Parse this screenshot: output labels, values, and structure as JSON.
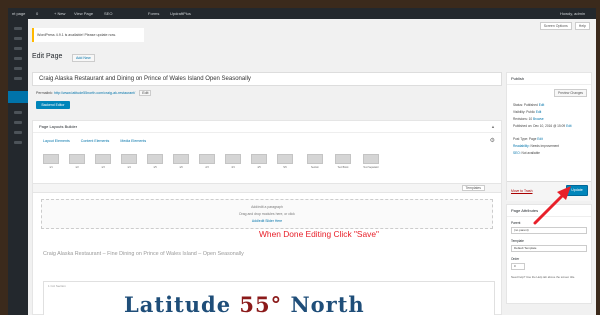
{
  "adminbar": {
    "site": "nt page",
    "comments": "0",
    "new": "+ New",
    "view": "View Page",
    "seo": "SEO",
    "forms": "Forms",
    "updraft": "UpdraftPlus",
    "howdy": "Howdy, admin"
  },
  "top_tabs": [
    "Screen Options",
    "Help"
  ],
  "notice": "WordPress 4.9.1 is available! Please update now.",
  "heading": {
    "title": "Edit Page",
    "add_new": "Add New"
  },
  "post_title": "Craig Alaska Restaurant and Dining on Prince of Wales Island Open Seasonally",
  "permalink": {
    "label": "Permalink:",
    "url": "http://www.latitude55north.com/craig-ak-restaurant/",
    "edit": "Edit"
  },
  "backend_button": "Backend Editor",
  "builder": {
    "title": "Page Layouts Builder",
    "tabs": [
      "Layout Elements",
      "Content Elements",
      "Media Elements"
    ],
    "layouts": [
      "1/1",
      "1/2",
      "1/3",
      "1/4",
      "1/5",
      "1/6",
      "2/3",
      "3/4",
      "4/5",
      "5/6",
      "Section",
      "Text Block",
      "Text Separator"
    ],
    "templates_button": "Templates",
    "drop_lines": [
      "Add/edit a paragraph",
      "Drag and drop modules here, or click",
      "Add/edit Slider Here"
    ],
    "callout": "When Done Editing Click \"Save\"",
    "page_heading": "Craig Alaska Restaurant – Fine Dining on Prince of Wales Island – Open Seasonally",
    "row_label": "1 Col Section",
    "logo": {
      "word1": "Latitude",
      "num": "55°",
      "word2": "North"
    }
  },
  "publish": {
    "title": "Publish",
    "preview": "Preview Changes",
    "rows": [
      {
        "label": "Status:",
        "value": "Published",
        "link": "Edit"
      },
      {
        "label": "Visibility:",
        "value": "Public",
        "link": "Edit"
      },
      {
        "label": "Revisions:",
        "value": "10",
        "link": "Browse"
      },
      {
        "label": "Published on:",
        "value": "Dec 10, 2016 @ 15:09",
        "link": "Edit"
      },
      {
        "label": "Post Type:",
        "value": "Page",
        "link": "Edit"
      },
      {
        "label": "Readability:",
        "value": "Needs improvement",
        "link": ""
      },
      {
        "label": "SEO:",
        "value": "Not available",
        "link": ""
      }
    ],
    "trash": "Move to Trash",
    "update": "Update"
  },
  "attributes": {
    "title": "Page Attributes",
    "parent_label": "Parent",
    "parent_value": "(no parent)",
    "template_label": "Template",
    "template_value": "Default Template",
    "order_label": "Order",
    "order_value": "0",
    "help": "Need help? Use the Help tab above the screen title."
  },
  "colors": {
    "accent": "#0085ba",
    "callout": "#e8202a",
    "adminbar": "#23282d"
  }
}
